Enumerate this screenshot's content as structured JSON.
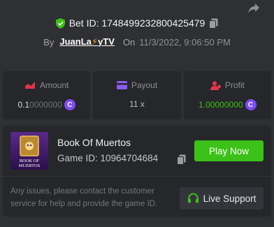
{
  "bet": {
    "label": "Bet ID: 1748499232800425479",
    "by_label": "By",
    "user_pre": "JuanLa",
    "user_bolt": "⚡",
    "user_post": "yTV",
    "on_label": "On",
    "date": "11/3/2022, 9:06:50 PM"
  },
  "stats": {
    "amount": {
      "label": "Amount",
      "value_main": "0.1",
      "value_dim": "0000000",
      "coin": "C"
    },
    "payout": {
      "label": "Payout",
      "value": "11 x"
    },
    "profit": {
      "label": "Profit",
      "value": "1.00000000",
      "coin": "C"
    }
  },
  "game": {
    "name": "Book Of Muertos",
    "id_label": "Game ID: 10964704684",
    "play_label": "Play Now",
    "thumb_text_1": "BOOK OF",
    "thumb_text_2": "MUERTOS"
  },
  "support": {
    "notice": "Any issues, please contact the customer service for help and provide the game ID.",
    "button_label": "Live Support"
  },
  "colors": {
    "accent_green": "#3bc117",
    "coin_purple": "#7d4cf5",
    "profit_green": "#3bc117",
    "background": "#2f3033",
    "card": "#26272a"
  },
  "icons": {
    "share": "share-icon",
    "shield": "shield-check-icon",
    "copy": "copy-icon",
    "amount": "amount-icon",
    "payout": "card-icon",
    "profit": "profit-icon",
    "headset": "headset-icon"
  }
}
